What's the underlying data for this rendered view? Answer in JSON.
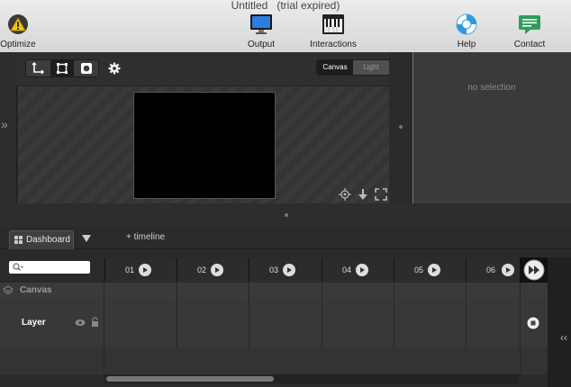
{
  "window": {
    "title": "Untitled",
    "title_note": "(trial expired)"
  },
  "toolbar": {
    "optimize": "Optimize",
    "output": "Output",
    "interactions": "Interactions",
    "help": "Help",
    "contact": "Contact"
  },
  "canvas": {
    "tool_icons": [
      "transform-icon",
      "frame-icon",
      "record-icon"
    ],
    "settings_icon": "gear-icon",
    "mode_canvas": "Canvas",
    "mode_light": "Light",
    "side_toggle": "»",
    "stage_color": "#000000"
  },
  "inspector": {
    "empty_text": "no selection"
  },
  "tabs": {
    "dashboard": "Dashboard",
    "add_timeline": "+ timeline"
  },
  "timeline": {
    "frames": [
      "01",
      "02",
      "03",
      "04",
      "05",
      "06"
    ],
    "group_label": "Canvas",
    "layer_label": "Layer",
    "collapse_icon": "‹‹"
  }
}
